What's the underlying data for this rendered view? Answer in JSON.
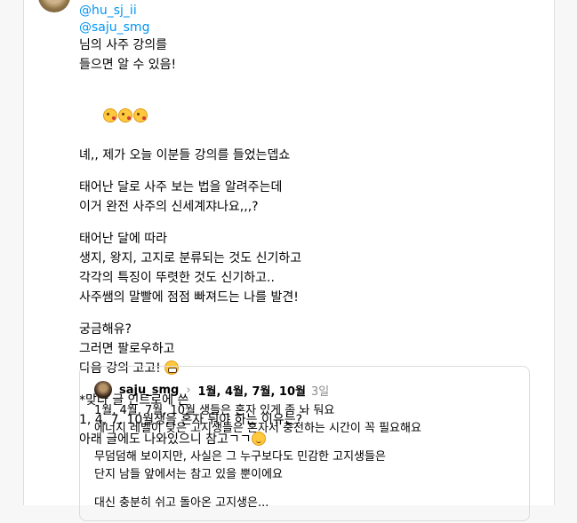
{
  "post": {
    "mentions": [
      "@hu_sj_ii",
      "@saju_smg"
    ],
    "paragraphs": [
      [
        "님의 사주 강의를",
        "들으면 알 수 있음!"
      ],
      [
        "",
        "녜,, 제가 오늘 이분들 강의를 들었는뎁쇼"
      ],
      [
        "태어난 달로 사주 보는 법을 알려주는데",
        "이거 완전 사주의 신세계쟈나요,,,?"
      ],
      [
        "태어난 달에 따라",
        "생지, 왕지, 고지로 분류되는 것도 신기하고",
        "각각의 특징이 뚜렷한 것도 신기하고..",
        "사주쌤의 말빨에 점점 빠져드는 나를 발견!"
      ],
      [
        "궁금해유?",
        "그러면 팔로우하고",
        "다음 강의 고고! "
      ],
      [
        "*맞다 글 인트로에 쓴",
        "1, 4, 7, 10월생을 혼자 둬야 하는 이유는?",
        "아래 글에도 나와있으니 참고ㄱㄱ"
      ]
    ]
  },
  "quoted": {
    "username": "saju_smg",
    "chevron": "›",
    "title": "1월, 4월, 7월, 10월",
    "time": "3일",
    "paragraphs": [
      [
        "1월, 4월, 7월, 10월 생들은 혼자 있게 좀 놔 둬요",
        "에너지 레벨이 낮은 고지생들은 혼자서 충전하는 시간이 꼭 필요해요"
      ],
      [
        "무덤덤해 보이지만, 사실은 그 누구보다도 민감한 고지생들은",
        "단지 남들 앞에서는 참고 있을 뿐이에요"
      ],
      [
        "대신 충분히 쉬고 돌아온 고지생은..."
      ]
    ]
  }
}
